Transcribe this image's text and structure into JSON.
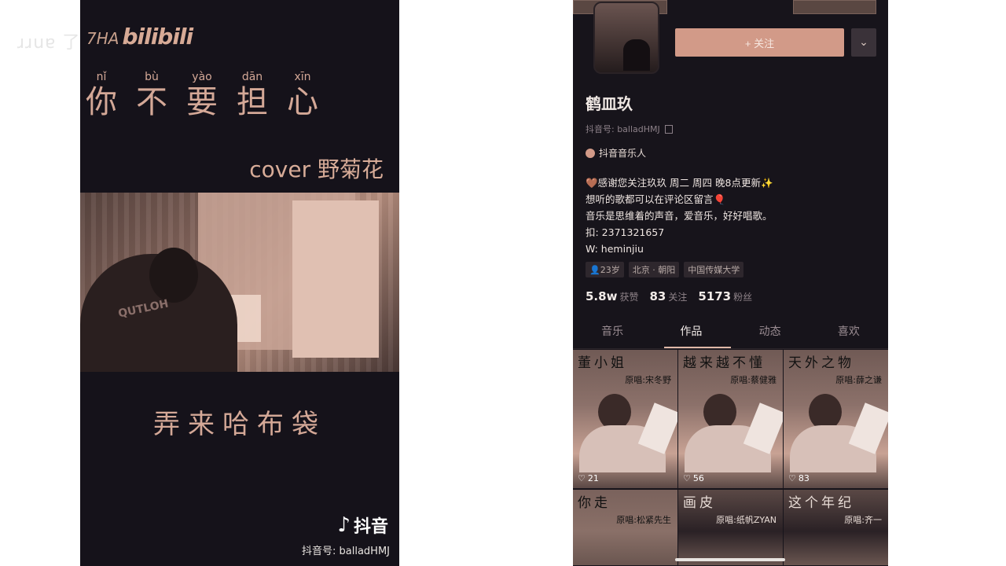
{
  "left_watermark": "ɹɹuɐ 了HA",
  "video": {
    "bili_prefix": "7HA",
    "bili_logo": "bilibili",
    "lyric_top": [
      {
        "pinyin": "nǐ",
        "hanzi": "你"
      },
      {
        "pinyin": "bù",
        "hanzi": "不"
      },
      {
        "pinyin": "yào",
        "hanzi": "要"
      },
      {
        "pinyin": "dān",
        "hanzi": "担"
      },
      {
        "pinyin": "xīn",
        "hanzi": "心"
      }
    ],
    "cover_line": "cover 野菊花",
    "shirt_text": "QUTLOH",
    "lyric_bottom": "弄来哈布袋",
    "douyin_logo": "抖音",
    "douyin_id": "抖音号: balladHMJ"
  },
  "profile": {
    "follow_label": "+ 关注",
    "more_icon": "chevron-down-icon",
    "name": "鹤皿玖",
    "douyin_id": "抖音号: balladHMJ",
    "tag": "抖音音乐人",
    "bio": [
      "🤎感谢您关注玖玖 周二 周四 晚8点更新✨",
      "想听的歌都可以在评论区留言🎈",
      "音乐是思维着的声音，爱音乐，好好唱歌。",
      "扣: 2371321657",
      "W: heminjiu"
    ],
    "chips": [
      "👤23岁",
      "北京 · 朝阳",
      "中国传媒大学"
    ],
    "stats": [
      {
        "num": "5.8w",
        "label": "获赞"
      },
      {
        "num": "83",
        "label": "关注"
      },
      {
        "num": "5173",
        "label": "粉丝"
      }
    ],
    "tabs": [
      "音乐",
      "作品",
      "动态",
      "喜欢"
    ],
    "active_tab": "作品",
    "videos": [
      {
        "title": "董小姐",
        "orig": "原唱:宋冬野",
        "likes": "21"
      },
      {
        "title": "越来越不懂",
        "orig": "原唱:蔡健雅",
        "likes": "56"
      },
      {
        "title": "天外之物",
        "orig": "原唱:薛之谦",
        "likes": "83"
      },
      {
        "title": "你走",
        "orig": "原唱:松紧先生",
        "likes": ""
      },
      {
        "title": "画皮",
        "orig": "原唱:纸帆ZYAN",
        "likes": ""
      },
      {
        "title": "这个年纪",
        "orig": "原唱:齐一",
        "likes": ""
      }
    ]
  }
}
